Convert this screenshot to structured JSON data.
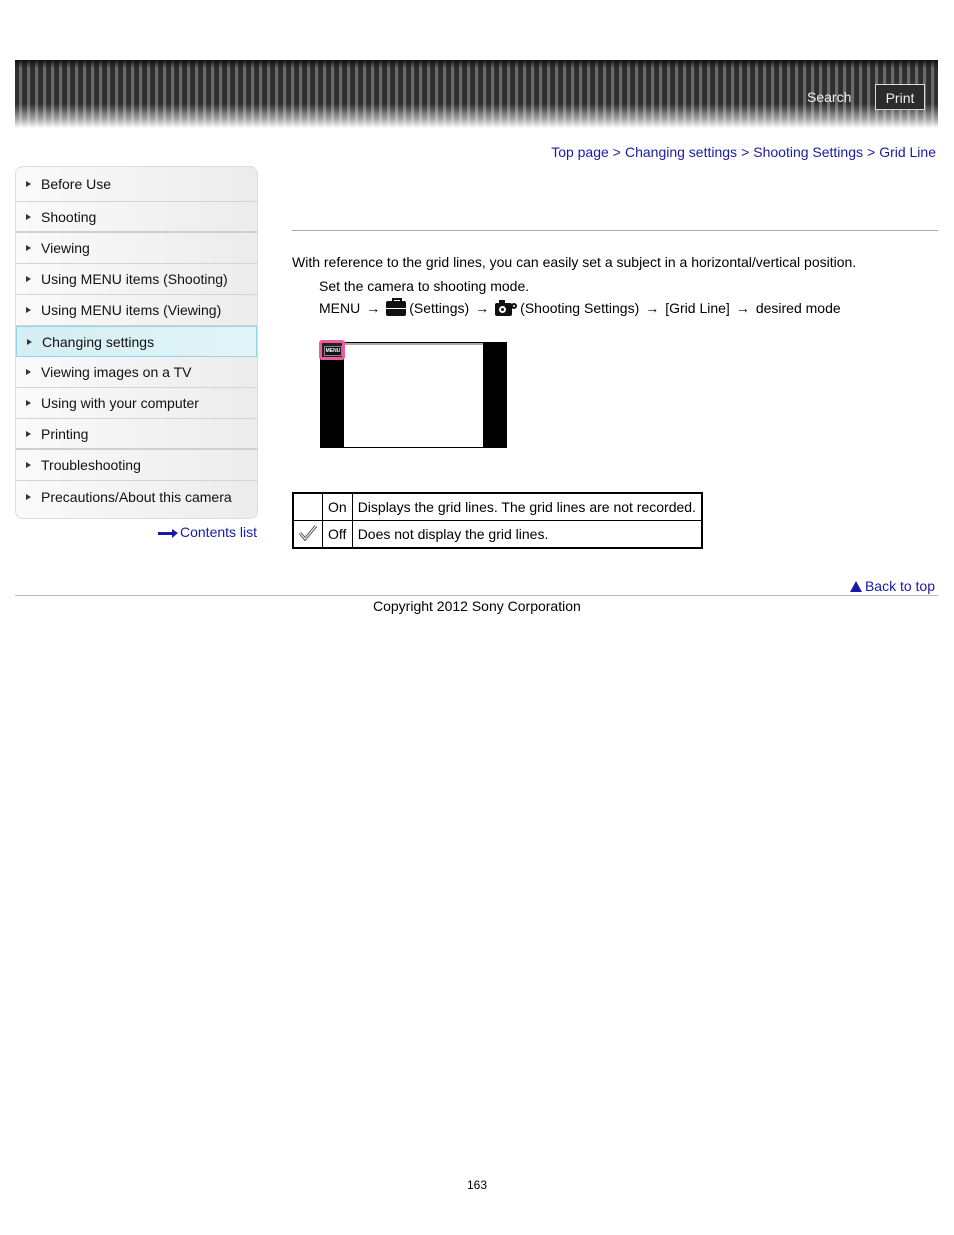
{
  "header": {
    "search_label": "Search",
    "print_label": "Print"
  },
  "breadcrumb": {
    "items": [
      "Top page",
      "Changing settings",
      "Shooting Settings",
      "Grid Line"
    ],
    "separator": ">"
  },
  "sidebar": {
    "items": [
      {
        "label": "Before Use",
        "active": false
      },
      {
        "label": "Shooting",
        "active": false
      },
      {
        "label": "Viewing",
        "active": false
      },
      {
        "label": "Using MENU items (Shooting)",
        "active": false
      },
      {
        "label": "Using MENU items (Viewing)",
        "active": false
      },
      {
        "label": "Changing settings",
        "active": true
      },
      {
        "label": "Viewing images on a TV",
        "active": false
      },
      {
        "label": "Using with your computer",
        "active": false
      },
      {
        "label": "Printing",
        "active": false
      },
      {
        "label": "Troubleshooting",
        "active": false
      },
      {
        "label": "Precautions/About this camera",
        "active": false
      }
    ],
    "contents_link": "Contents list"
  },
  "main": {
    "intro": "With reference to the grid lines, you can easily set a subject in a horizontal/vertical position.",
    "step": "Set the camera to shooting mode.",
    "menu_path": {
      "menu": "MENU",
      "arrow": "→",
      "settings_icon": "toolbox-icon",
      "settings": "(Settings)",
      "shooting_icon": "camera-settings-icon",
      "shooting": "(Shooting Settings)",
      "item": "[Grid Line]",
      "final": "desired mode"
    },
    "screen_menu_button": "MENU",
    "options": [
      {
        "default": false,
        "name": "On",
        "description": "Displays the grid lines. The grid lines are not recorded."
      },
      {
        "default": true,
        "name": "Off",
        "description": "Does not display the grid lines."
      }
    ]
  },
  "footer": {
    "back_to_top": "Back to top",
    "copyright": "Copyright 2012 Sony Corporation",
    "page_number": "163"
  },
  "colors": {
    "link": "#1a1aa6",
    "active_nav": "#d4eef3",
    "menu_highlight": "#f05aa0"
  }
}
